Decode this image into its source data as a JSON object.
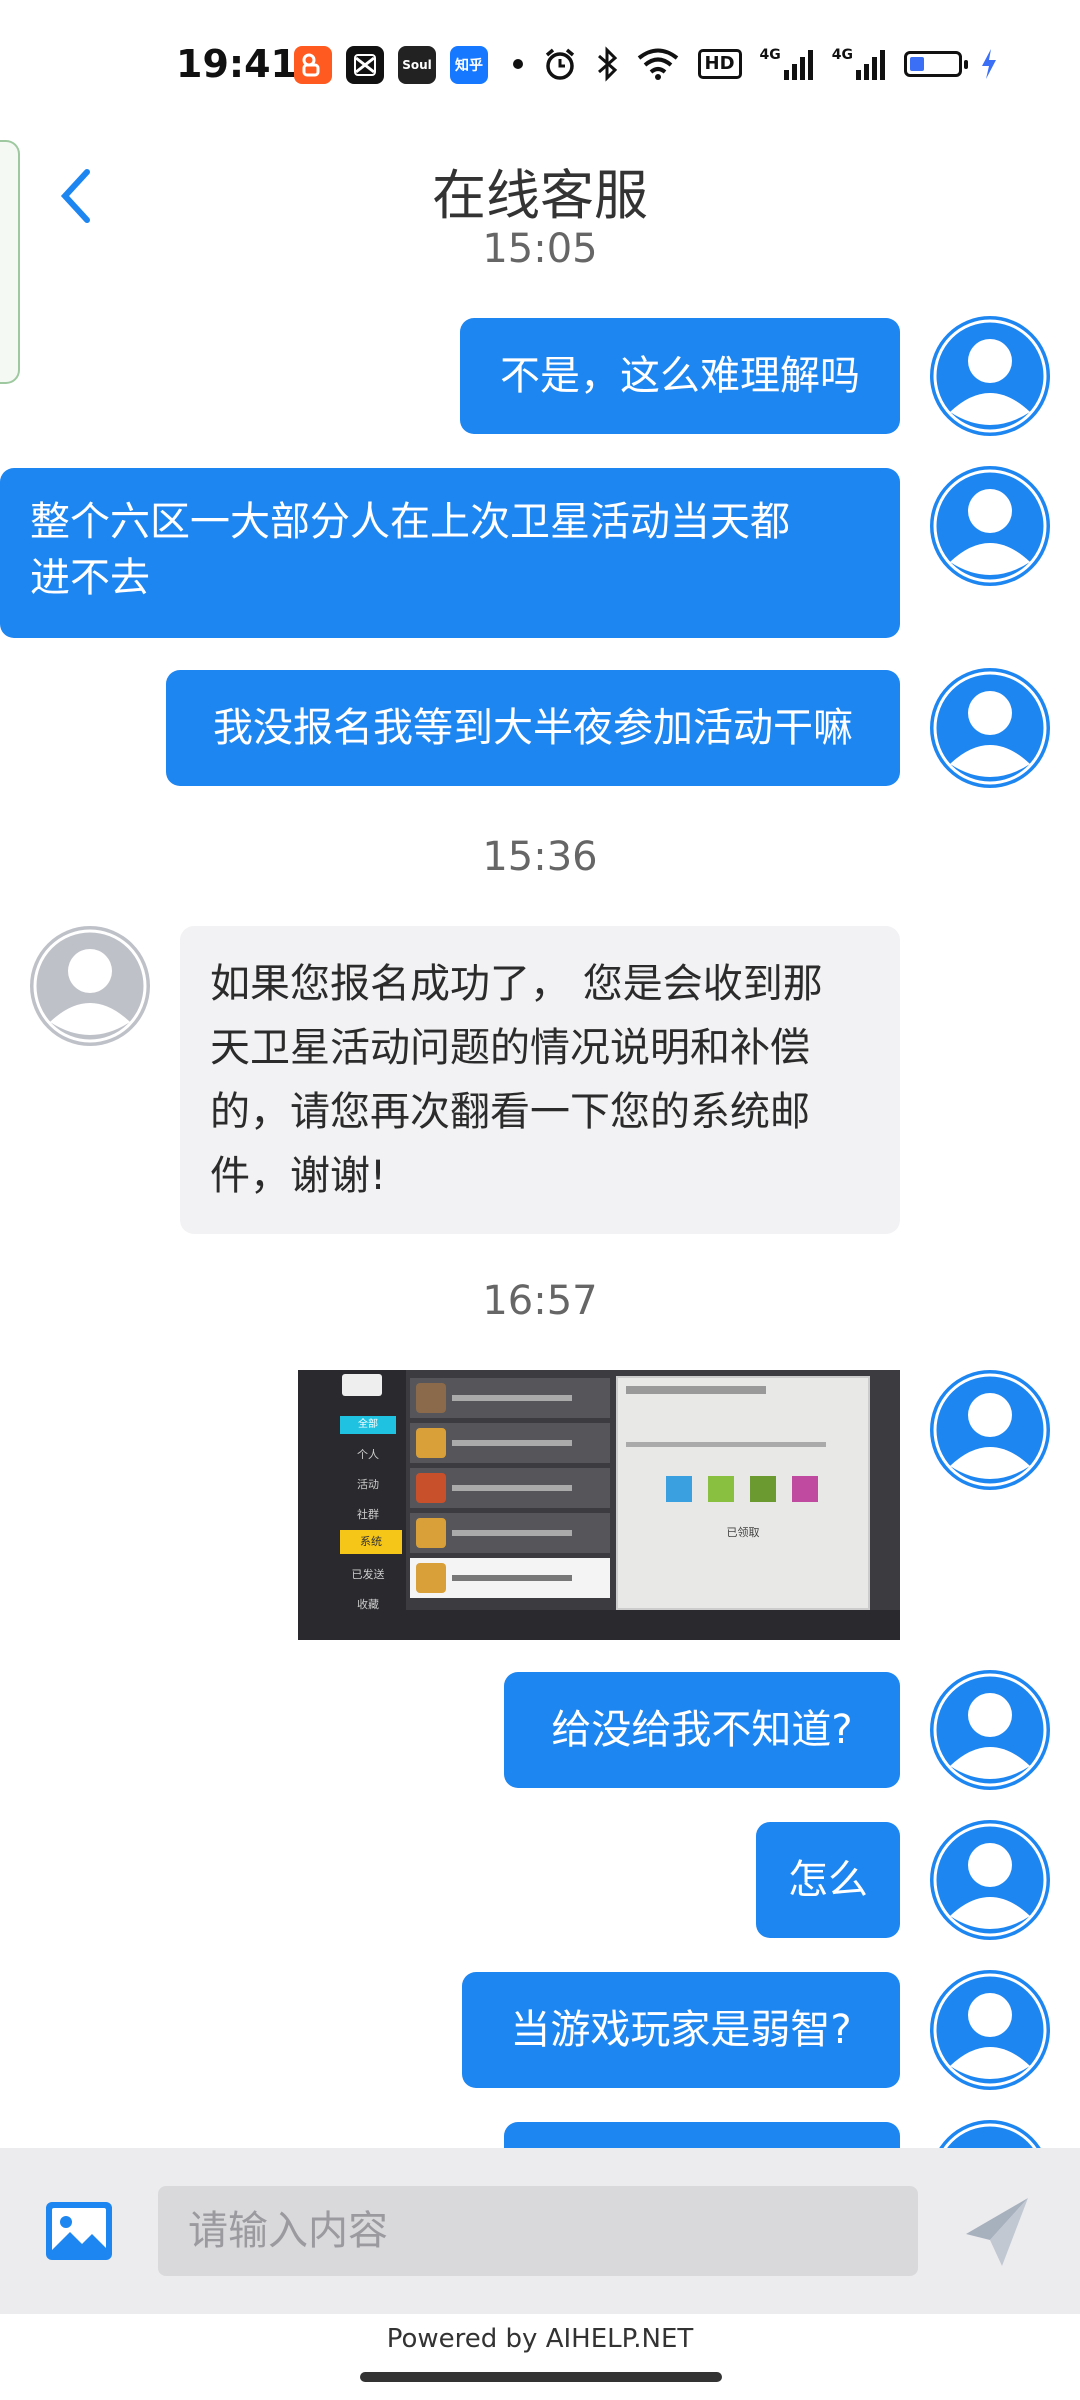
{
  "status_bar": {
    "time": "19:41",
    "apps": [
      {
        "icon": "kuaishou-icon",
        "label": "",
        "color": "#ff5a1f"
      },
      {
        "icon": "capcut-icon",
        "label": "",
        "color": "#111111"
      },
      {
        "icon": "soul-icon",
        "label": "Soul",
        "color": "#222222"
      },
      {
        "icon": "zhihu-icon",
        "label": "知乎",
        "color": "#1677ff"
      }
    ],
    "network": [
      "4G",
      "4G"
    ],
    "hd_label": "HD"
  },
  "header": {
    "title": "在线客服"
  },
  "messages": {
    "ts1": "15:05",
    "u1": "不是，这么难理解吗",
    "u2_line1": "整个六区一大部分人在上次卫星活动当天都",
    "u2_line2": "进不去",
    "u3": "我没报名我等到大半夜参加活动干嘛",
    "ts2": "15:36",
    "a1_line1": "如果您报名成功了， 您是会收到那",
    "a1_line2": "天卫星活动问题的情况说明和补偿",
    "a1_line3": "的，请您再次翻看一下您的系统邮",
    "a1_line4": "件，谢谢!",
    "ts3": "16:57",
    "u4": "给没给我不知道?",
    "u5": "怎么",
    "u6": "当游戏玩家是弱智?"
  },
  "screenshot": {
    "menu": [
      "全部",
      "个人",
      "活动",
      "社群",
      "系统",
      "已发送",
      "收藏"
    ],
    "selected": "系统",
    "panel_caption": "已领取"
  },
  "input": {
    "placeholder": "请输入内容"
  },
  "footer": {
    "powered": "Powered by AIHELP.NET"
  },
  "colors": {
    "user_bubble": "#1e86f1",
    "agent_bubble": "#f2f2f4",
    "user_avatar": "#1e86f1",
    "agent_avatar": "#bfc1c9"
  }
}
